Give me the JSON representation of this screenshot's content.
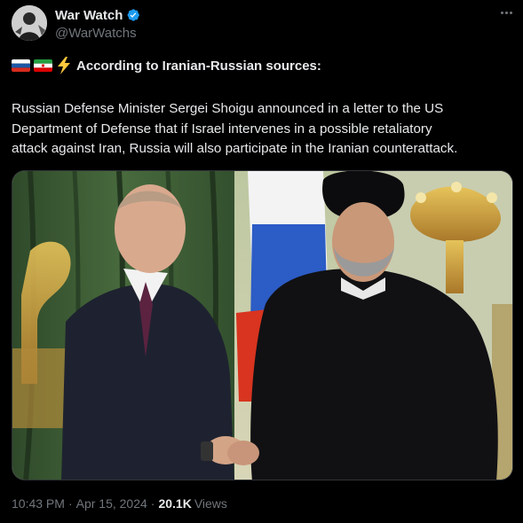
{
  "author": {
    "display_name": "War Watch",
    "handle": "@WarWatchs",
    "avatar_icon": "avatar-illustration",
    "verified_icon": "verified-badge-icon",
    "verified_color": "#1d9bf0"
  },
  "more_icon": "more-options-icon",
  "headline": {
    "flags": [
      "russia-flag-icon",
      "iran-flag-icon"
    ],
    "emoji": "lightning-bolt-icon",
    "text": "According to Iranian-Russian sources:"
  },
  "body": {
    "line1": "Russian Defense Minister Sergei Shoigu announced in a letter to the US",
    "line2": "Department of Defense that if Israel intervenes in a possible retaliatory",
    "line3": "attack against Iran, Russia will also participate in the Iranian counterattack."
  },
  "media": {
    "alt": "photo"
  },
  "footer": {
    "time": "10:43 PM",
    "separator": "·",
    "date": "Apr 15, 2024",
    "views_count": "20.1K",
    "views_label": "Views"
  }
}
